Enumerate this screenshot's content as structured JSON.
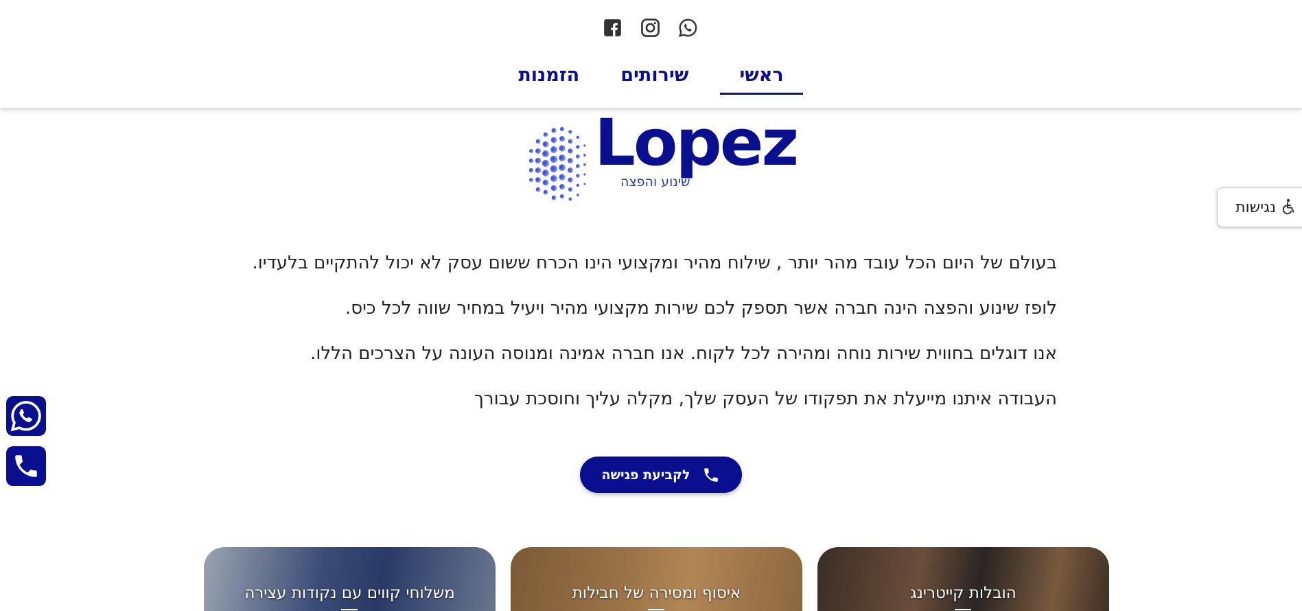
{
  "header": {
    "social": [
      "facebook-icon",
      "instagram-icon",
      "whatsapp-icon"
    ],
    "nav": [
      {
        "label": "ראשי",
        "active": true
      },
      {
        "label": "שירותים",
        "active": false
      },
      {
        "label": "הזמנות",
        "active": false
      }
    ]
  },
  "logo": {
    "word": "Lopez",
    "subtitle": "שינוע והפצה"
  },
  "accessibility": {
    "label": "נגישות",
    "icon": "wheelchair-icon"
  },
  "intro": [
    "בעולם של היום הכל עובד מהר יותר , שילוח מהיר ומקצועי הינו הכרח ששום עסק לא יכול להתקיים בלעדיו.",
    "לופז שינוע והפצה הינה חברה אשר תספק לכם שירות מקצועי מהיר ויעיל במחיר שווה לכל כיס.",
    "אנו דוגלים בחווית שירות נוחה ומהירה לכל לקוח. אנו חברה אמינה ומנוסה העונה על הצרכים הללו.",
    "העבודה איתנו מייעלת את תפקודו של העסק שלך, מקלה עליך וחוסכת עבורך"
  ],
  "cta": {
    "label": "לקביעת פגישה",
    "icon": "phone-icon"
  },
  "floating": [
    "whatsapp-icon",
    "phone-icon"
  ],
  "cards": [
    {
      "title": "הובלות קייטרינג"
    },
    {
      "title": "איסוף ומסירה של חבילות"
    },
    {
      "title": "משלוחי קווים עם נקודות עצירה"
    }
  ],
  "colors": {
    "brand": "#0a0f8f",
    "text": "#222222",
    "background": "#ffffff"
  }
}
